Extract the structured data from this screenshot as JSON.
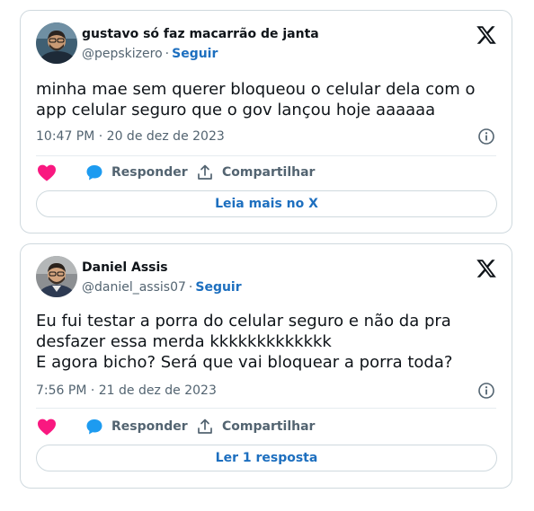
{
  "tweets": [
    {
      "author_name": "gustavo só faz macarrão de janta",
      "handle": "@pepskizero",
      "separator": "·",
      "follow_label": "Seguir",
      "text": "minha mae sem querer bloqueou o celular dela com o\napp celular seguro que o gov lançou hoje aaaaaa",
      "timestamp": "10:47 PM · 20 de dez de 2023",
      "actions": {
        "reply_label": "Responder",
        "share_label": "Compartilhar"
      },
      "footer_button": "Leia mais no X"
    },
    {
      "author_name": "Daniel Assis",
      "handle": "@daniel_assis07",
      "separator": "·",
      "follow_label": "Seguir",
      "text": "Eu fui testar a porra do celular seguro e não da pra\ndesfazer essa merda kkkkkkkkkkkkk\nE agora bicho? Será que vai bloquear a porra toda?",
      "timestamp": "7:56 PM · 21 de dez de 2023",
      "actions": {
        "reply_label": "Responder",
        "share_label": "Compartilhar"
      },
      "footer_button": "Ler 1 resposta"
    }
  ],
  "colors": {
    "like": "#f91880",
    "reply": "#1d9bf0",
    "link": "#1d6fbf",
    "secondary_text": "#536471",
    "border": "#cfd9de"
  },
  "icons": [
    "x-logo-icon",
    "info-icon",
    "heart-icon",
    "reply-bubble-icon",
    "share-icon"
  ]
}
